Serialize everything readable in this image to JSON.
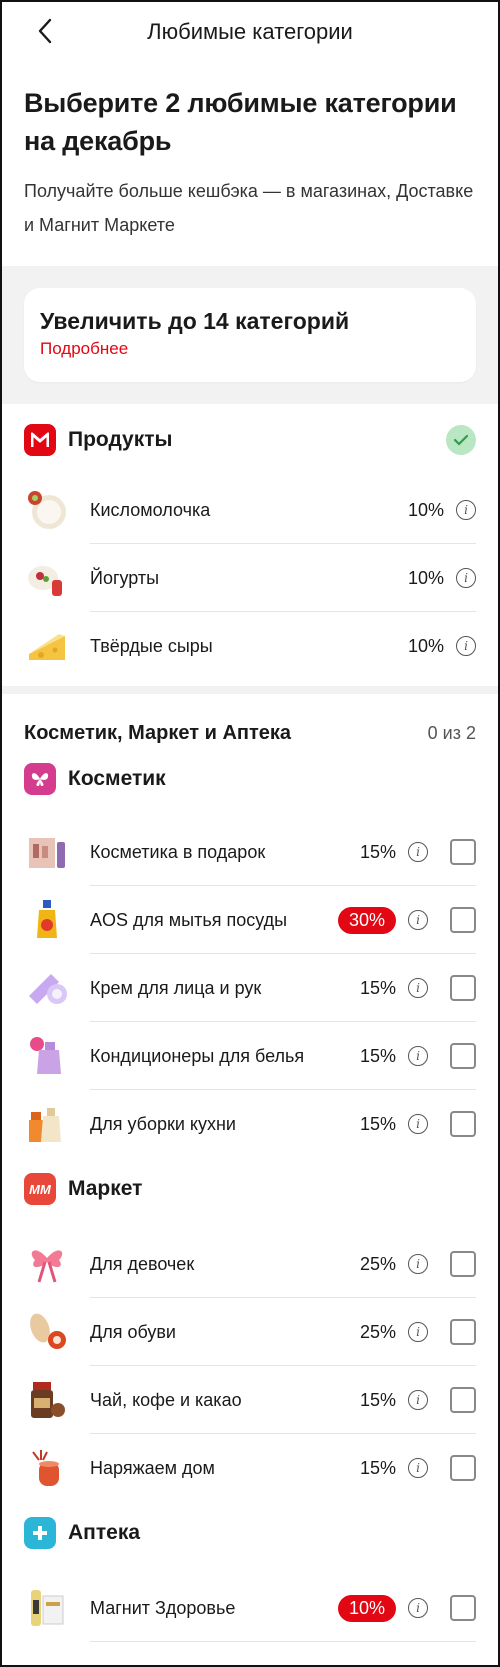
{
  "header": {
    "title": "Любимые категории"
  },
  "hero": {
    "title": "Выберите 2 любимые категории на декабрь",
    "subtitle": "Получайте больше кешбэка — в магазинах, Доставке и Магнит Маркете"
  },
  "promo": {
    "title": "Увеличить до 14 категорий",
    "link": "Подробнее"
  },
  "products": {
    "brand": "Продукты",
    "items": [
      {
        "label": "Кисломолочка",
        "percent": "10%"
      },
      {
        "label": "Йогурты",
        "percent": "10%"
      },
      {
        "label": "Твёрдые сыры",
        "percent": "10%"
      }
    ]
  },
  "group": {
    "title": "Косметик, Маркет и Аптека",
    "count": "0 из 2"
  },
  "cosmetic": {
    "brand": "Косметик",
    "items": [
      {
        "label": "Косметика в подарок",
        "percent": "15%"
      },
      {
        "label": "AOS для мытья посуды",
        "percent": "30%"
      },
      {
        "label": "Крем для лица и рук",
        "percent": "15%"
      },
      {
        "label": "Кондиционеры для белья",
        "percent": "15%"
      },
      {
        "label": "Для уборки кухни",
        "percent": "15%"
      }
    ]
  },
  "market": {
    "brand": "Маркет",
    "badge": "MM",
    "items": [
      {
        "label": "Для девочек",
        "percent": "25%"
      },
      {
        "label": "Для обуви",
        "percent": "25%"
      },
      {
        "label": "Чай, кофе и какао",
        "percent": "15%"
      },
      {
        "label": "Наряжаем дом",
        "percent": "15%"
      }
    ]
  },
  "pharmacy": {
    "brand": "Аптека",
    "items": [
      {
        "label": "Магнит Здоровье",
        "percent": "10%"
      }
    ]
  },
  "info_glyph": "i",
  "colors": {
    "accent": "#e30613",
    "check_bg": "#b9e6c3",
    "cosmetic": "#d63c8e",
    "pharmacy": "#2bb5d6"
  }
}
